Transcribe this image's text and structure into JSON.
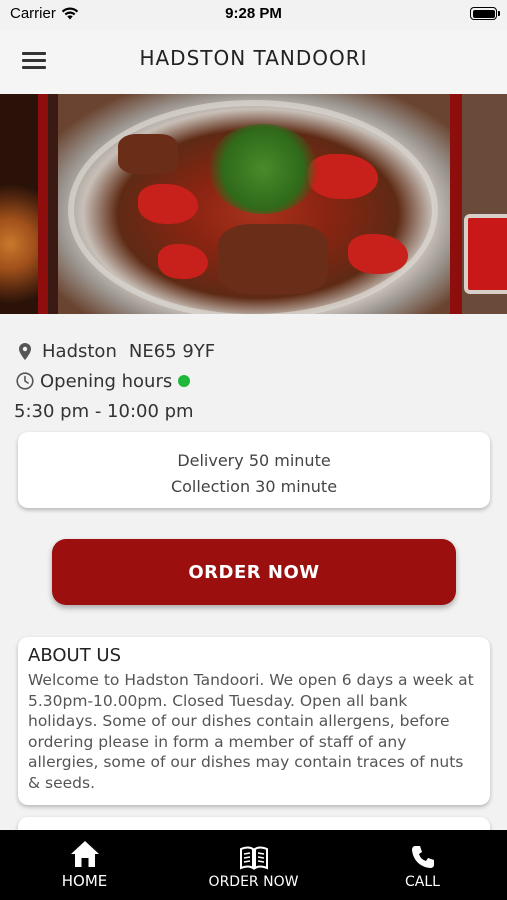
{
  "status_bar": {
    "carrier": "Carrier",
    "time": "9:28 PM"
  },
  "header": {
    "title": "HADSTON TANDOORI",
    "menu_icon": "hamburger-menu-icon"
  },
  "info": {
    "town": "Hadston",
    "postcode": "NE65 9YF",
    "opening_label": "Opening hours",
    "open_status_color": "#1db83a",
    "hours": "5:30 pm - 10:00 pm"
  },
  "delivery": {
    "delivery_time": "Delivery 50 minute",
    "collection_time": "Collection 30 minute"
  },
  "order_button": {
    "label": "ORDER NOW",
    "color": "#9c0f0f"
  },
  "about": {
    "title": "ABOUT US",
    "text": "Welcome to Hadston Tandoori. We open 6 days a week at 5.30pm-10.00pm. Closed Tuesday. Open all bank holidays. Some of our dishes contain allergens, before ordering please in form a member of staff of any allergies, some of our dishes may contain traces of nuts & seeds."
  },
  "tab_bar": {
    "tabs": [
      {
        "label": "HOME",
        "icon": "home-icon"
      },
      {
        "label": "ORDER NOW",
        "icon": "menu-book-icon"
      },
      {
        "label": "CALL",
        "icon": "phone-icon"
      }
    ]
  }
}
